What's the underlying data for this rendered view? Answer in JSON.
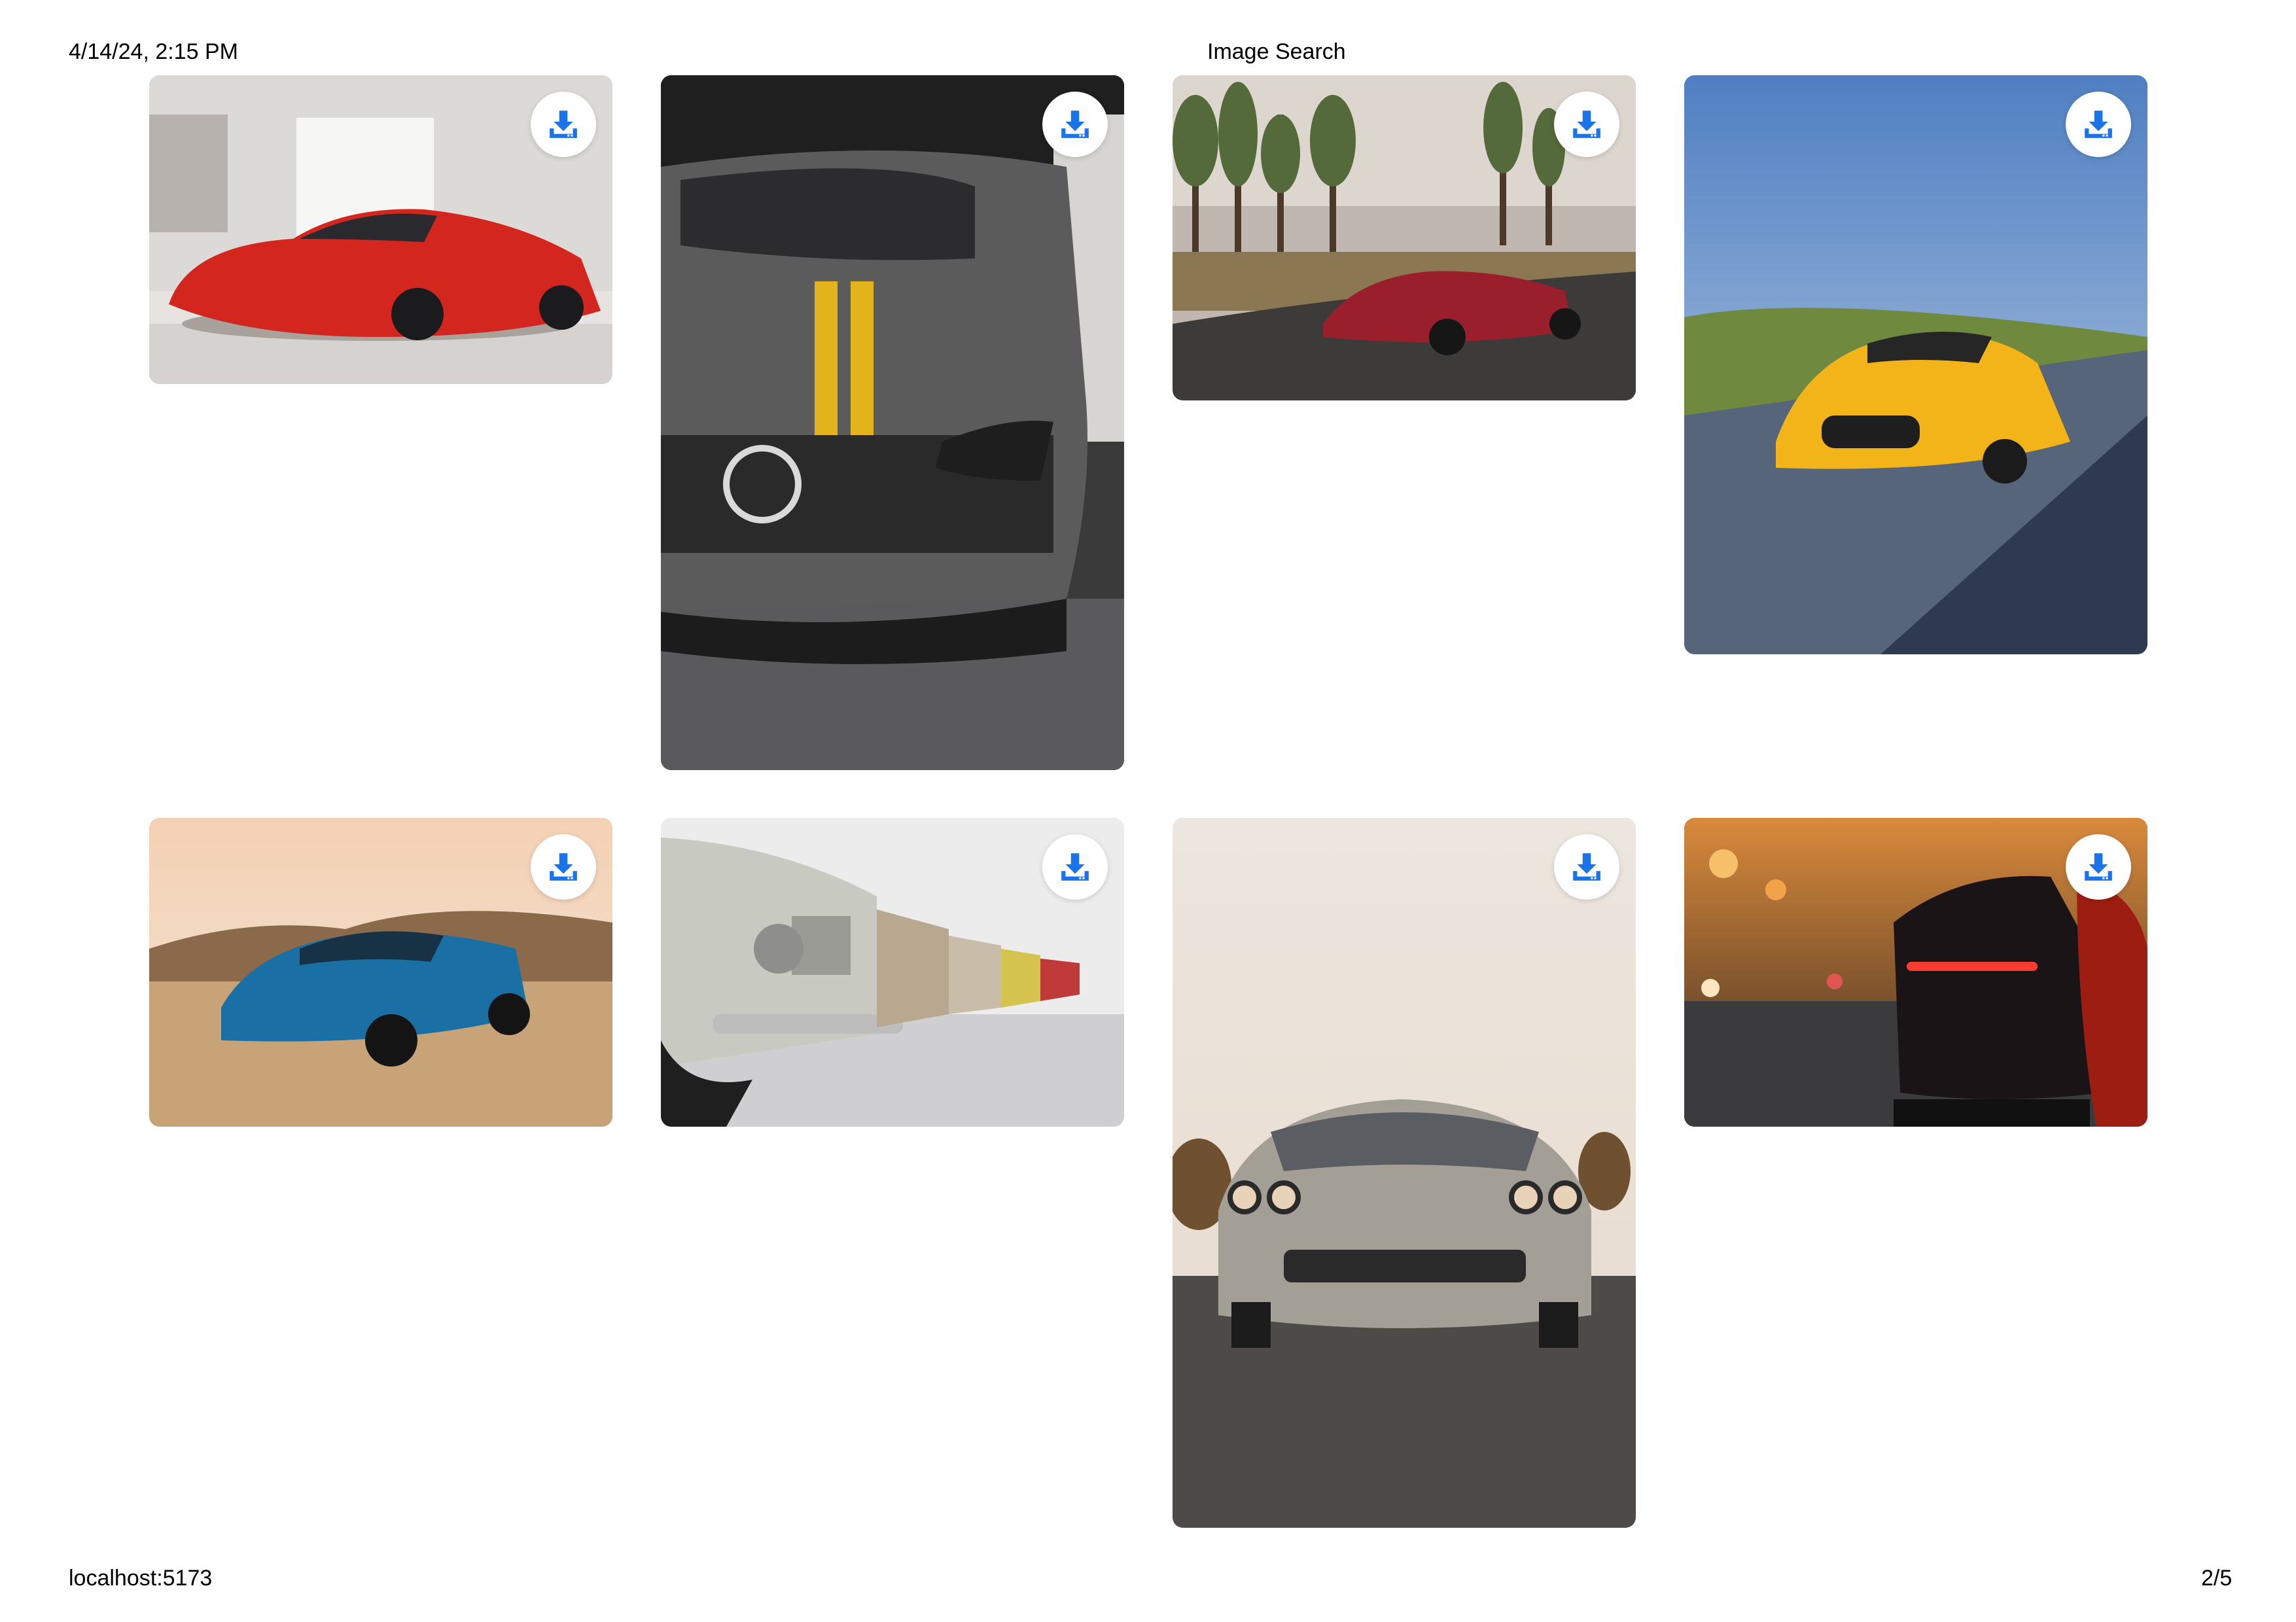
{
  "print_header": {
    "datetime": "4/14/24, 2:15 PM",
    "title": "Image Search"
  },
  "print_footer": {
    "url": "localhost:5173",
    "page": "2/5"
  },
  "gallery": {
    "accent_color": "#1a73e8",
    "download_icon": "download-icon",
    "images": [
      {
        "subject": "red-sports-car-showroom"
      },
      {
        "subject": "grey-sedan-yellow-stripe"
      },
      {
        "subject": "red-coupe-forest-road"
      },
      {
        "subject": "yellow-coupe-road"
      },
      {
        "subject": "blue-muscle-car-desert"
      },
      {
        "subject": "classic-cars-row"
      },
      {
        "subject": "silver-muscle-car-front"
      },
      {
        "subject": "dark-sports-car-street-night"
      }
    ]
  }
}
